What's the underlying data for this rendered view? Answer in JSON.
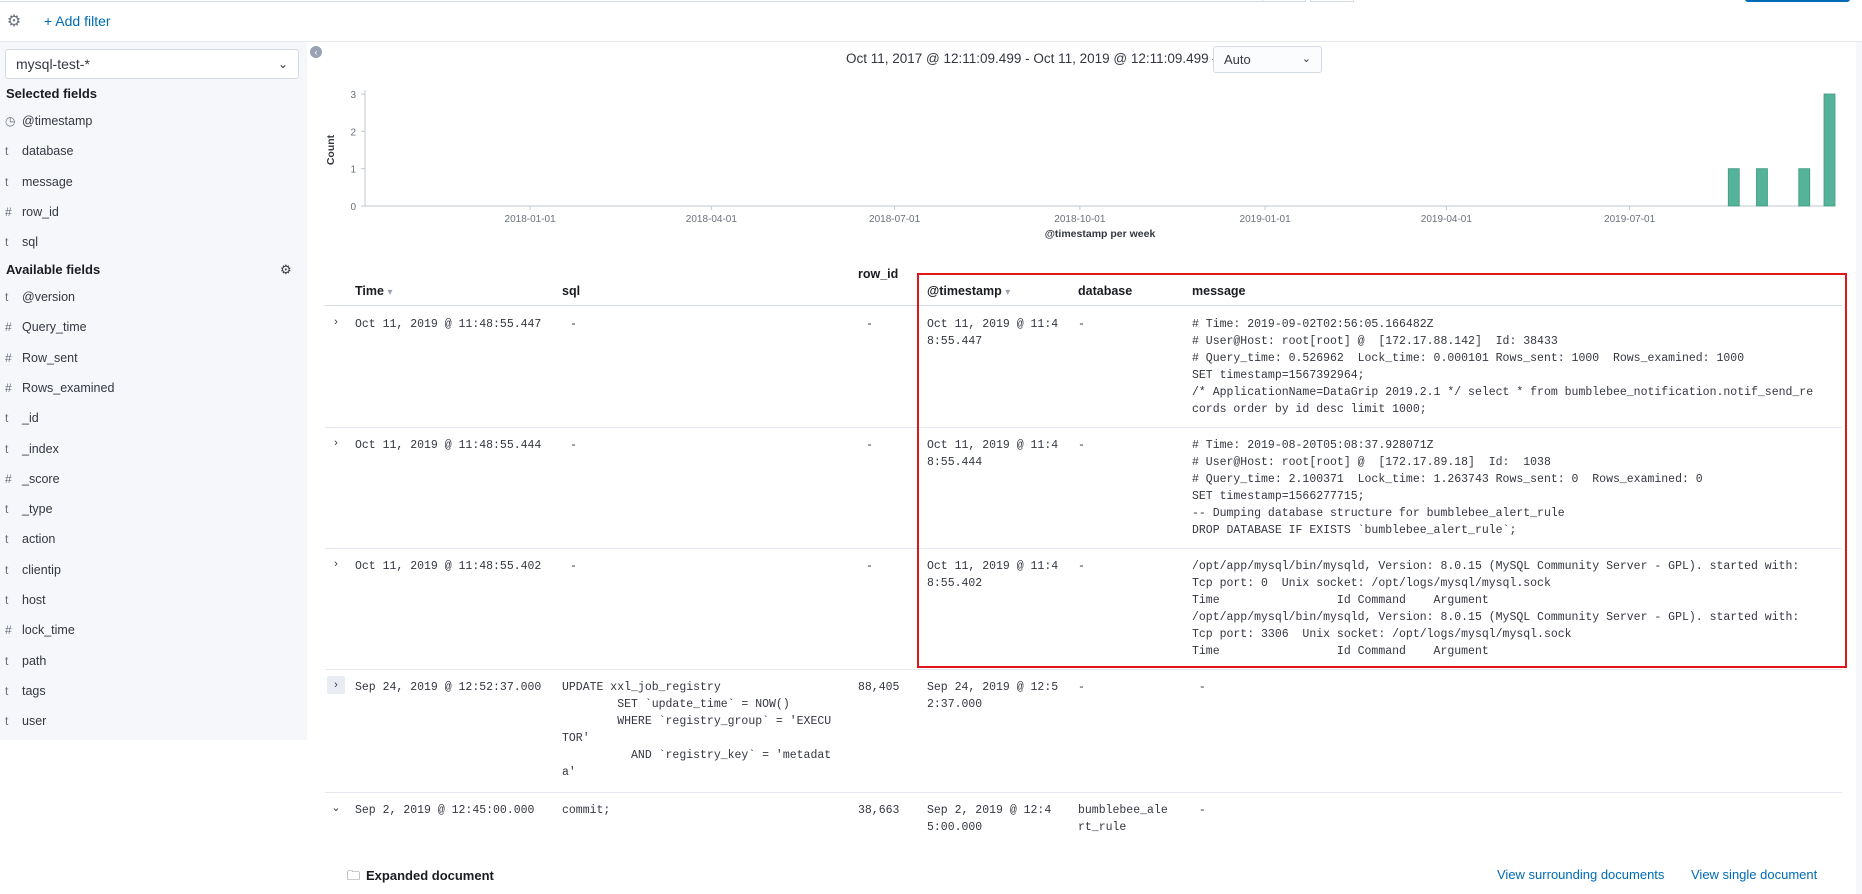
{
  "filter_bar": {
    "add_filter_label": "+ Add filter",
    "settings_icon": "gear-icon"
  },
  "sidebar": {
    "index_pattern": "mysql-test-*",
    "selected_title": "Selected fields",
    "available_title": "Available fields",
    "selected_fields": [
      {
        "type": "clock",
        "name": "@timestamp"
      },
      {
        "type": "t",
        "name": "database"
      },
      {
        "type": "t",
        "name": "message"
      },
      {
        "type": "#",
        "name": "row_id"
      },
      {
        "type": "t",
        "name": "sql"
      }
    ],
    "available_fields": [
      {
        "type": "t",
        "name": "@version"
      },
      {
        "type": "#",
        "name": "Query_time"
      },
      {
        "type": "#",
        "name": "Row_sent"
      },
      {
        "type": "#",
        "name": "Rows_examined"
      },
      {
        "type": "t",
        "name": "_id"
      },
      {
        "type": "t",
        "name": "_index"
      },
      {
        "type": "#",
        "name": "_score"
      },
      {
        "type": "t",
        "name": "_type"
      },
      {
        "type": "t",
        "name": "action"
      },
      {
        "type": "t",
        "name": "clientip"
      },
      {
        "type": "t",
        "name": "host"
      },
      {
        "type": "#",
        "name": "lock_time"
      },
      {
        "type": "t",
        "name": "path"
      },
      {
        "type": "t",
        "name": "tags"
      },
      {
        "type": "t",
        "name": "user"
      }
    ]
  },
  "header": {
    "time_range": "Oct 11, 2017 @ 12:11:09.499 - Oct 11, 2019 @ 12:11:09.499 —",
    "interval": "Auto"
  },
  "chart_data": {
    "type": "bar",
    "xlabel": "@timestamp per week",
    "ylabel": "Count",
    "ylim": [
      0,
      3
    ],
    "yticks": [
      "0",
      "1",
      "2",
      "3"
    ],
    "xticks": [
      "2018-01-01",
      "2018-04-01",
      "2018-07-01",
      "2018-10-01",
      "2019-01-01",
      "2019-04-01",
      "2019-07-01"
    ],
    "x": [
      "2019-08-19",
      "2019-09-02",
      "2019-09-23",
      "2019-10-07"
    ],
    "values": [
      1,
      1,
      1,
      3
    ],
    "bar_color": "#54b399"
  },
  "table": {
    "columns": {
      "time": "Time",
      "sql": "sql",
      "row_id": "row_id",
      "timestamp": "@timestamp",
      "database": "database",
      "message": "message"
    },
    "rows": [
      {
        "time": "Oct 11, 2019 @ 11:48:55.447",
        "sql": "-",
        "row_id": "-",
        "timestamp": "Oct 11, 2019 @ 11:4\n8:55.447",
        "database": "-",
        "message": "# Time: 2019-09-02T02:56:05.166482Z\n# User@Host: root[root] @  [172.17.88.142]  Id: 38433\n# Query_time: 0.526962  Lock_time: 0.000101 Rows_sent: 1000  Rows_examined: 1000\nSET timestamp=1567392964;\n/* ApplicationName=DataGrip 2019.2.1 */ select * from bumblebee_notification.notif_send_re\ncords order by id desc limit 1000;"
      },
      {
        "time": "Oct 11, 2019 @ 11:48:55.444",
        "sql": "-",
        "row_id": "-",
        "timestamp": "Oct 11, 2019 @ 11:4\n8:55.444",
        "database": "-",
        "message": "# Time: 2019-08-20T05:08:37.928071Z\n# User@Host: root[root] @  [172.17.89.18]  Id:  1038\n# Query_time: 2.100371  Lock_time: 1.263743 Rows_sent: 0  Rows_examined: 0\nSET timestamp=1566277715;\n-- Dumping database structure for bumblebee_alert_rule\nDROP DATABASE IF EXISTS `bumblebee_alert_rule`;"
      },
      {
        "time": "Oct 11, 2019 @ 11:48:55.402",
        "sql": "-",
        "row_id": "-",
        "timestamp": "Oct 11, 2019 @ 11:4\n8:55.402",
        "database": "-",
        "message": "/opt/app/mysql/bin/mysqld, Version: 8.0.15 (MySQL Community Server - GPL). started with:\nTcp port: 0  Unix socket: /opt/logs/mysql/mysql.sock\nTime                 Id Command    Argument\n/opt/app/mysql/bin/mysqld, Version: 8.0.15 (MySQL Community Server - GPL). started with:\nTcp port: 3306  Unix socket: /opt/logs/mysql/mysql.sock\nTime                 Id Command    Argument"
      },
      {
        "time": "Sep 24, 2019 @ 12:52:37.000",
        "sql": "UPDATE xxl_job_registry\n        SET `update_time` = NOW()\n        WHERE `registry_group` = 'EXECU\nTOR'\n          AND `registry_key` = 'metadat\na'",
        "row_id": "88,405",
        "timestamp": "Sep 24, 2019 @ 12:5\n2:37.000",
        "database": "-",
        "message": " -"
      },
      {
        "time": "Sep 2, 2019 @ 12:45:00.000",
        "sql": "commit;",
        "row_id": "38,663",
        "timestamp": "Sep 2, 2019 @ 12:4\n5:00.000",
        "database": "bumblebee_ale\nrt_rule",
        "message": " -"
      }
    ]
  },
  "expanded": {
    "title": "Expanded document",
    "view_surrounding": "View surrounding documents",
    "view_single": "View single document"
  }
}
